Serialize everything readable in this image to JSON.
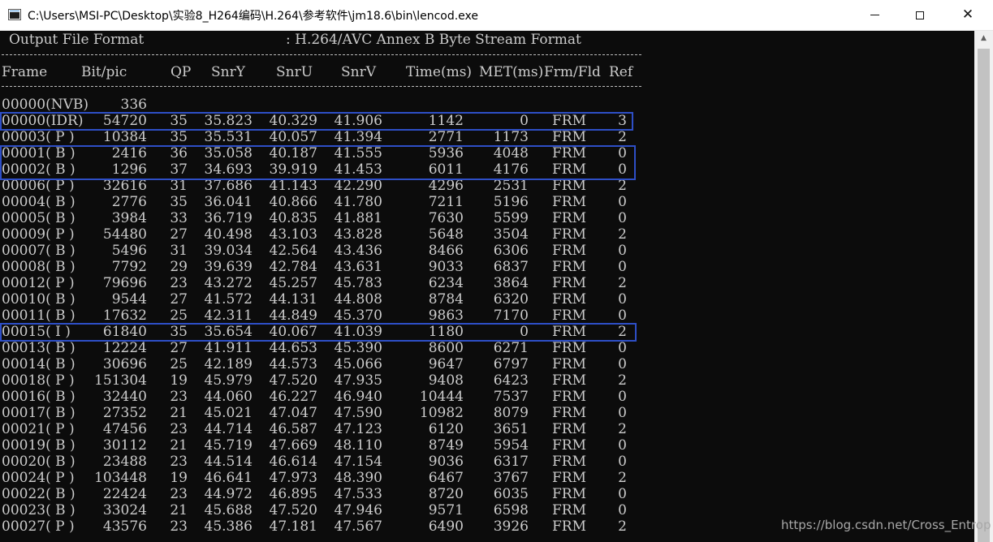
{
  "window": {
    "title": "C:\\Users\\MSI-PC\\Desktop\\实验8_H264编码\\H.264\\参考软件\\jm18.6\\bin\\lencod.exe",
    "icon": "console-window-icon",
    "controls": {
      "minimize": "minimize-icon",
      "maximize": "maximize-icon",
      "close": "✕"
    }
  },
  "console": {
    "format_label": "Output File Format",
    "format_value": ": H.264/AVC Annex B Byte Stream Format",
    "headers": [
      "Frame",
      "Bit/pic",
      "QP",
      "SnrY",
      "SnrU",
      "SnrV",
      "Time(ms)",
      "MET(ms)",
      "Frm/Fld",
      "Ref"
    ],
    "nvb_row": {
      "frame": "00000(NVB)",
      "bits": "336"
    },
    "rows": [
      [
        "00000(IDR)",
        "54720",
        "35",
        "35.823",
        "40.329",
        "41.906",
        "1142",
        "0",
        "FRM",
        "3"
      ],
      [
        "00003( P )",
        "10384",
        "35",
        "35.531",
        "40.057",
        "41.394",
        "2771",
        "1173",
        "FRM",
        "2"
      ],
      [
        "00001( B )",
        "2416",
        "36",
        "35.058",
        "40.187",
        "41.555",
        "5936",
        "4048",
        "FRM",
        "0"
      ],
      [
        "00002( B )",
        "1296",
        "37",
        "34.693",
        "39.919",
        "41.453",
        "6011",
        "4176",
        "FRM",
        "0"
      ],
      [
        "00006( P )",
        "32616",
        "31",
        "37.686",
        "41.143",
        "42.290",
        "4296",
        "2531",
        "FRM",
        "2"
      ],
      [
        "00004( B )",
        "2776",
        "35",
        "36.041",
        "40.866",
        "41.780",
        "7211",
        "5196",
        "FRM",
        "0"
      ],
      [
        "00005( B )",
        "3984",
        "33",
        "36.719",
        "40.835",
        "41.881",
        "7630",
        "5599",
        "FRM",
        "0"
      ],
      [
        "00009( P )",
        "54480",
        "27",
        "40.498",
        "43.103",
        "43.828",
        "5648",
        "3504",
        "FRM",
        "2"
      ],
      [
        "00007( B )",
        "5496",
        "31",
        "39.034",
        "42.564",
        "43.436",
        "8466",
        "6306",
        "FRM",
        "0"
      ],
      [
        "00008( B )",
        "7792",
        "29",
        "39.639",
        "42.784",
        "43.631",
        "9033",
        "6837",
        "FRM",
        "0"
      ],
      [
        "00012( P )",
        "79696",
        "23",
        "43.272",
        "45.257",
        "45.783",
        "6234",
        "3864",
        "FRM",
        "2"
      ],
      [
        "00010( B )",
        "9544",
        "27",
        "41.572",
        "44.131",
        "44.808",
        "8784",
        "6320",
        "FRM",
        "0"
      ],
      [
        "00011( B )",
        "17632",
        "25",
        "42.311",
        "44.849",
        "45.370",
        "9863",
        "7170",
        "FRM",
        "0"
      ],
      [
        "00015( I )",
        "61840",
        "35",
        "35.654",
        "40.067",
        "41.039",
        "1180",
        "0",
        "FRM",
        "2"
      ],
      [
        "00013( B )",
        "12224",
        "27",
        "41.911",
        "44.653",
        "45.390",
        "8600",
        "6271",
        "FRM",
        "0"
      ],
      [
        "00014( B )",
        "30696",
        "25",
        "42.189",
        "44.573",
        "45.066",
        "9647",
        "6797",
        "FRM",
        "0"
      ],
      [
        "00018( P )",
        "151304",
        "19",
        "45.979",
        "47.520",
        "47.935",
        "9408",
        "6423",
        "FRM",
        "2"
      ],
      [
        "00016( B )",
        "32440",
        "23",
        "44.060",
        "46.227",
        "46.940",
        "10444",
        "7537",
        "FRM",
        "0"
      ],
      [
        "00017( B )",
        "27352",
        "21",
        "45.021",
        "47.047",
        "47.590",
        "10982",
        "8079",
        "FRM",
        "0"
      ],
      [
        "00021( P )",
        "47456",
        "23",
        "44.714",
        "46.587",
        "47.123",
        "6120",
        "3651",
        "FRM",
        "2"
      ],
      [
        "00019( B )",
        "30112",
        "21",
        "45.719",
        "47.669",
        "48.110",
        "8749",
        "5954",
        "FRM",
        "0"
      ],
      [
        "00020( B )",
        "23488",
        "23",
        "44.514",
        "46.614",
        "47.154",
        "9036",
        "6317",
        "FRM",
        "0"
      ],
      [
        "00024( P )",
        "103448",
        "19",
        "46.641",
        "47.973",
        "48.390",
        "6467",
        "3767",
        "FRM",
        "2"
      ],
      [
        "00022( B )",
        "22424",
        "23",
        "44.972",
        "46.895",
        "47.533",
        "8720",
        "6035",
        "FRM",
        "0"
      ],
      [
        "00023( B )",
        "33024",
        "21",
        "45.688",
        "47.520",
        "47.946",
        "9571",
        "6598",
        "FRM",
        "0"
      ],
      [
        "00027( P )",
        "43576",
        "23",
        "45.386",
        "47.181",
        "47.567",
        "6490",
        "3926",
        "FRM",
        "2"
      ]
    ],
    "highlight_color": "#2e4fc7",
    "text_color": "#cccccc",
    "background_color": "#0c0c0c"
  },
  "watermark": "https://blog.csdn.net/Cross_Entrop",
  "scrollbar": {
    "up_arrow": "▲"
  }
}
